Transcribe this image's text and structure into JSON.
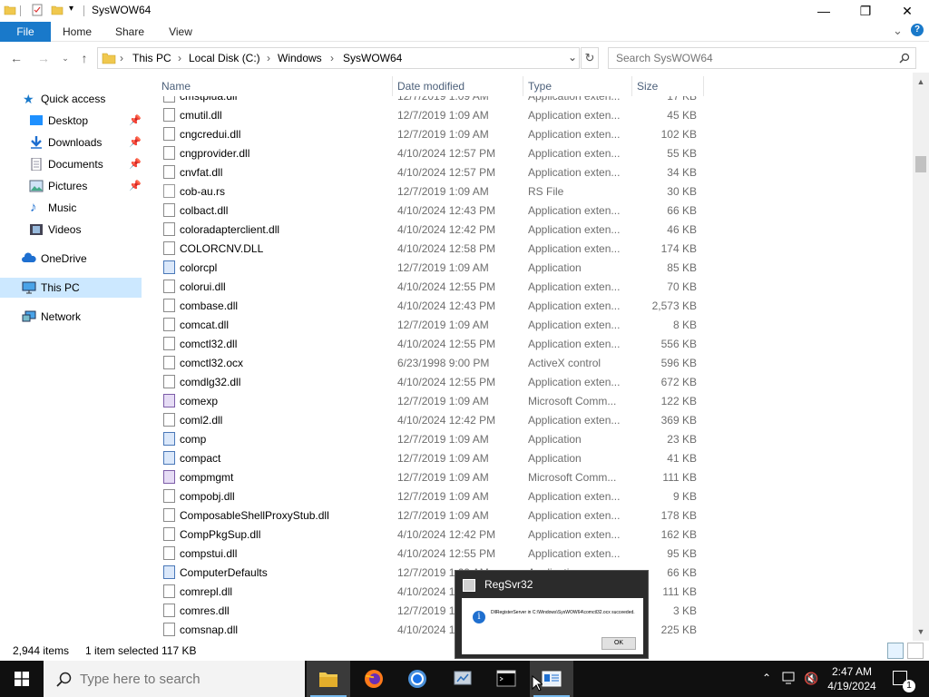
{
  "window": {
    "title": "SysWOW64",
    "minimize": "—",
    "maximize": "❐",
    "close": "✕"
  },
  "ribbon": {
    "tabs": [
      "File",
      "Home",
      "Share",
      "View"
    ],
    "expand": "⌄",
    "help": "?"
  },
  "address": {
    "crumbs": [
      "This PC",
      "Local Disk (C:)",
      "Windows",
      "SysWOW64"
    ],
    "separator": "›",
    "search_placeholder": "Search SysWOW64"
  },
  "nav": {
    "quick_access": "Quick access",
    "items": [
      "Desktop",
      "Downloads",
      "Documents",
      "Pictures",
      "Music",
      "Videos"
    ],
    "pinned": [
      true,
      true,
      true,
      true,
      false,
      false
    ],
    "onedrive": "OneDrive",
    "this_pc": "This PC",
    "network": "Network"
  },
  "columns": {
    "name": "Name",
    "date": "Date modified",
    "type": "Type",
    "size": "Size"
  },
  "files": [
    {
      "name": "cmstplua.dll",
      "date": "12/7/2019 1:09 AM",
      "type": "Application exten...",
      "size": "17 KB",
      "icon": "dll"
    },
    {
      "name": "cmutil.dll",
      "date": "12/7/2019 1:09 AM",
      "type": "Application exten...",
      "size": "45 KB",
      "icon": "dll"
    },
    {
      "name": "cngcredui.dll",
      "date": "12/7/2019 1:09 AM",
      "type": "Application exten...",
      "size": "102 KB",
      "icon": "dll"
    },
    {
      "name": "cngprovider.dll",
      "date": "4/10/2024 12:57 PM",
      "type": "Application exten...",
      "size": "55 KB",
      "icon": "dll"
    },
    {
      "name": "cnvfat.dll",
      "date": "4/10/2024 12:57 PM",
      "type": "Application exten...",
      "size": "34 KB",
      "icon": "dll"
    },
    {
      "name": "cob-au.rs",
      "date": "12/7/2019 1:09 AM",
      "type": "RS File",
      "size": "30 KB",
      "icon": "rs"
    },
    {
      "name": "colbact.dll",
      "date": "4/10/2024 12:43 PM",
      "type": "Application exten...",
      "size": "66 KB",
      "icon": "dll"
    },
    {
      "name": "coloradapterclient.dll",
      "date": "4/10/2024 12:42 PM",
      "type": "Application exten...",
      "size": "46 KB",
      "icon": "dll"
    },
    {
      "name": "COLORCNV.DLL",
      "date": "4/10/2024 12:58 PM",
      "type": "Application exten...",
      "size": "174 KB",
      "icon": "dll"
    },
    {
      "name": "colorcpl",
      "date": "12/7/2019 1:09 AM",
      "type": "Application",
      "size": "85 KB",
      "icon": "app"
    },
    {
      "name": "colorui.dll",
      "date": "4/10/2024 12:55 PM",
      "type": "Application exten...",
      "size": "70 KB",
      "icon": "dll"
    },
    {
      "name": "combase.dll",
      "date": "4/10/2024 12:43 PM",
      "type": "Application exten...",
      "size": "2,573 KB",
      "icon": "dll"
    },
    {
      "name": "comcat.dll",
      "date": "12/7/2019 1:09 AM",
      "type": "Application exten...",
      "size": "8 KB",
      "icon": "dll"
    },
    {
      "name": "comctl32.dll",
      "date": "4/10/2024 12:55 PM",
      "type": "Application exten...",
      "size": "556 KB",
      "icon": "dll"
    },
    {
      "name": "comctl32.ocx",
      "date": "6/23/1998 9:00 PM",
      "type": "ActiveX control",
      "size": "596 KB",
      "icon": "dll"
    },
    {
      "name": "comdlg32.dll",
      "date": "4/10/2024 12:55 PM",
      "type": "Application exten...",
      "size": "672 KB",
      "icon": "dll"
    },
    {
      "name": "comexp",
      "date": "12/7/2019 1:09 AM",
      "type": "Microsoft Comm...",
      "size": "122 KB",
      "icon": "mmc"
    },
    {
      "name": "coml2.dll",
      "date": "4/10/2024 12:42 PM",
      "type": "Application exten...",
      "size": "369 KB",
      "icon": "dll"
    },
    {
      "name": "comp",
      "date": "12/7/2019 1:09 AM",
      "type": "Application",
      "size": "23 KB",
      "icon": "app"
    },
    {
      "name": "compact",
      "date": "12/7/2019 1:09 AM",
      "type": "Application",
      "size": "41 KB",
      "icon": "app"
    },
    {
      "name": "compmgmt",
      "date": "12/7/2019 1:09 AM",
      "type": "Microsoft Comm...",
      "size": "111 KB",
      "icon": "mmc"
    },
    {
      "name": "compobj.dll",
      "date": "12/7/2019 1:09 AM",
      "type": "Application exten...",
      "size": "9 KB",
      "icon": "dll"
    },
    {
      "name": "ComposableShellProxyStub.dll",
      "date": "12/7/2019 1:09 AM",
      "type": "Application exten...",
      "size": "178 KB",
      "icon": "dll"
    },
    {
      "name": "CompPkgSup.dll",
      "date": "4/10/2024 12:42 PM",
      "type": "Application exten...",
      "size": "162 KB",
      "icon": "dll"
    },
    {
      "name": "compstui.dll",
      "date": "4/10/2024 12:55 PM",
      "type": "Application exten...",
      "size": "95 KB",
      "icon": "dll"
    },
    {
      "name": "ComputerDefaults",
      "date": "12/7/2019 1:09 AM",
      "type": "Application",
      "size": "66 KB",
      "icon": "app"
    },
    {
      "name": "comrepl.dll",
      "date": "4/10/2024 12:43 PM",
      "type": "Application exten...",
      "size": "111 KB",
      "icon": "dll"
    },
    {
      "name": "comres.dll",
      "date": "12/7/2019 1:09 AM",
      "type": "Application exten...",
      "size": "3 KB",
      "icon": "dll"
    },
    {
      "name": "comsnap.dll",
      "date": "4/10/2024 12:43 PM",
      "type": "Application exten...",
      "size": "225 KB",
      "icon": "dll"
    }
  ],
  "status": {
    "count": "2,944 items",
    "selected": "1 item selected",
    "size": "117 KB"
  },
  "dialog": {
    "title": "RegSvr32",
    "message": "DllRegisterServer in C:\\Windows\\SysWOW64\\comctl32.ocx succeeded.",
    "ok": "OK"
  },
  "taskbar": {
    "search_placeholder": "Type here to search",
    "time": "2:47 AM",
    "date": "4/19/2024",
    "notifications": "1",
    "apps": [
      "file-explorer",
      "firefox",
      "chrome",
      "control-panel",
      "command-prompt",
      "regsvr32"
    ]
  },
  "colors": {
    "accent": "#1979ca",
    "selection": "#cce8ff",
    "taskbar": "#101010"
  }
}
